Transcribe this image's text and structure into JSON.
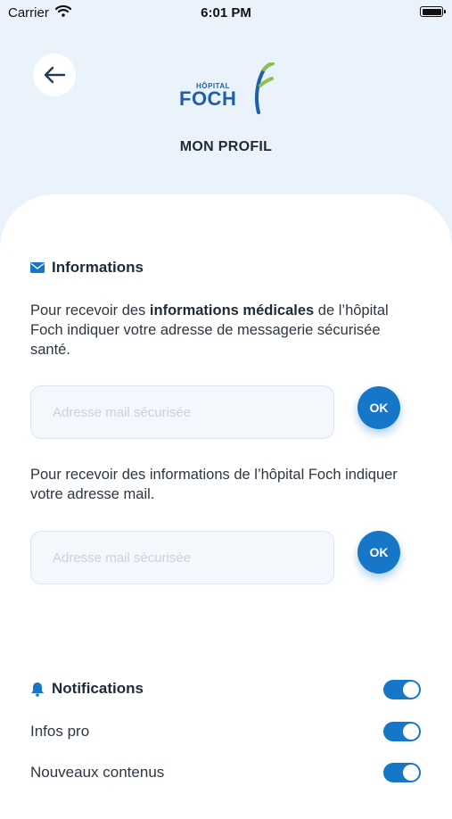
{
  "status_bar": {
    "carrier": "Carrier",
    "time": "6:01 PM"
  },
  "header": {
    "logo_small": "HÔPITAL",
    "logo_main": "FOCH",
    "title": "MON PROFIL"
  },
  "informations": {
    "heading": "Informations",
    "paragraph1": {
      "before": "Pour recevoir des ",
      "bold": "informations médicales",
      "after": " de l’hôpital Foch indiquer votre adresse de messagerie sécurisée santé."
    },
    "secure_email": {
      "placeholder": "Adresse mail sécurisée",
      "value": "",
      "ok_label": "OK"
    },
    "paragraph2": "Pour recevoir des informations de l’hôpital Foch indiquer votre adresse mail.",
    "email": {
      "placeholder": "Adresse mail sécurisée",
      "value": "",
      "ok_label": "OK"
    }
  },
  "notifications": {
    "heading": "Notifications",
    "enabled": true,
    "items": [
      {
        "label": "Infos pro",
        "enabled": true
      },
      {
        "label": "Nouveaux contenus",
        "enabled": true
      }
    ]
  },
  "colors": {
    "accent": "#1677c8",
    "header_bg": "#eaf3fb",
    "logo_blue": "#1d5fa8",
    "logo_green": "#8bc34a"
  },
  "icons": [
    "wifi-icon",
    "battery-icon",
    "back-arrow-icon",
    "mail-icon",
    "bell-icon"
  ]
}
